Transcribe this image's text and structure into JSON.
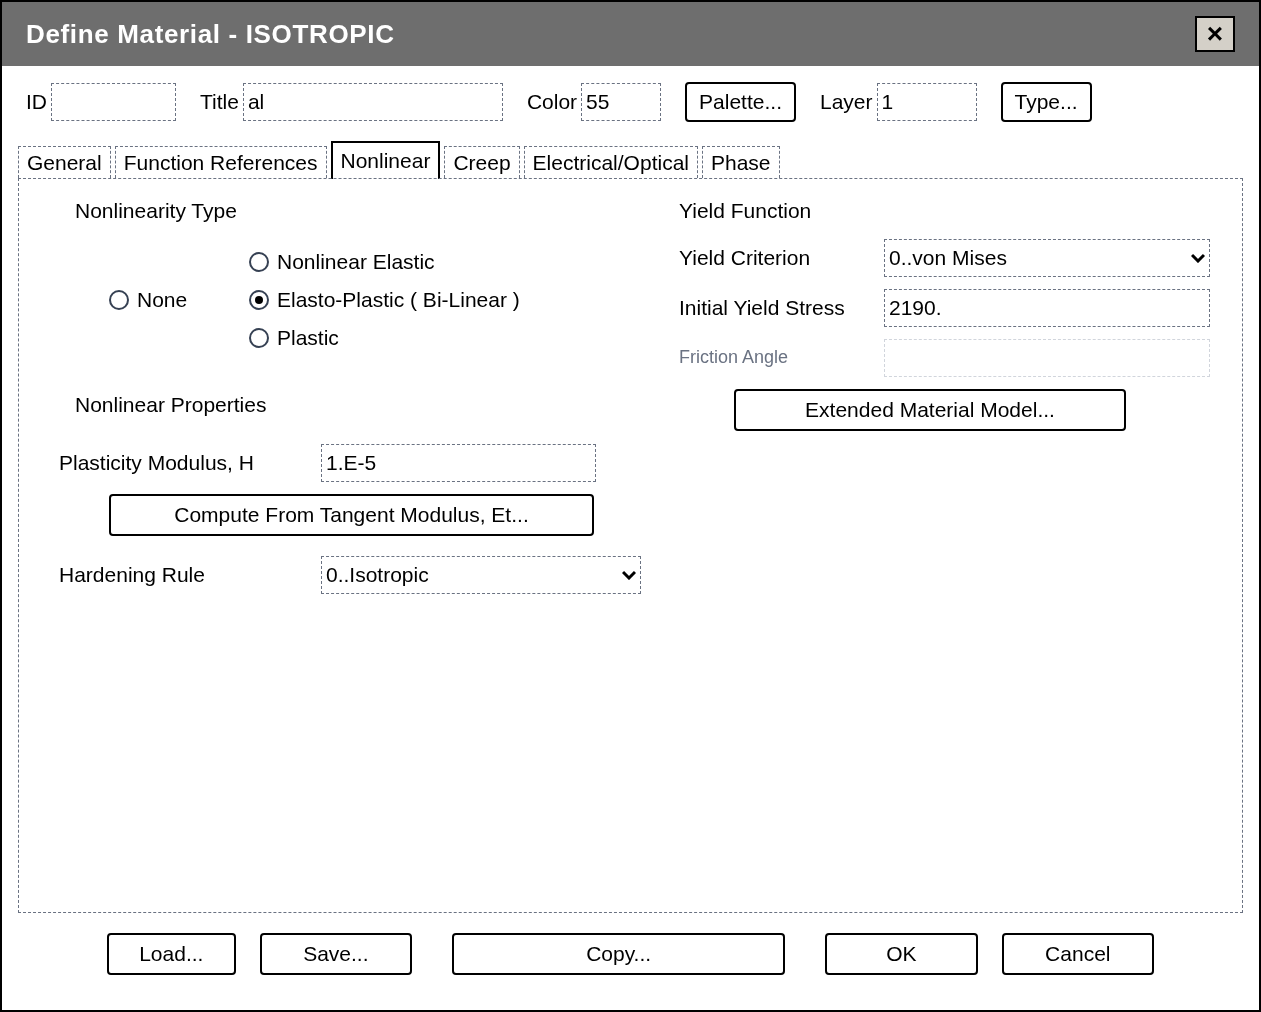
{
  "window": {
    "title": "Define Material - ISOTROPIC",
    "close": "×"
  },
  "header": [
    {
      "label": "ID",
      "kind": "field"
    },
    {
      "label": "Title",
      "value": "al",
      "kind": "field"
    },
    {
      "label": "Color",
      "value": "55",
      "kind": "field"
    },
    {
      "label": "Palette...",
      "kind": "button"
    },
    {
      "label": "Layer",
      "value": "1",
      "kind": "field"
    },
    {
      "label": "Type...",
      "kind": "button"
    }
  ],
  "tabs": [
    {
      "label": "General",
      "selected": false
    },
    {
      "label": "Function References",
      "selected": false
    },
    {
      "label": "Nonlinear",
      "selected": true
    },
    {
      "label": "Creep",
      "selected": false
    },
    {
      "label": "Electrical/Optical",
      "selected": false
    },
    {
      "label": "Phase",
      "selected": false
    }
  ],
  "nonlinearity_type": {
    "title": "Nonlinearity Type",
    "options": [
      {
        "label": "None",
        "selected": false
      },
      {
        "label": "Nonlinear Elastic",
        "selected": false
      },
      {
        "label": "Elasto-Plastic ( Bi-Linear )",
        "selected": true
      },
      {
        "label": "Plastic",
        "selected": false
      }
    ]
  },
  "nonlinear_properties": {
    "title": "Nonlinear Properties",
    "plasticity_modulus": {
      "label": "Plasticity Modulus, H",
      "value": "1.E-5"
    },
    "compute_button": "Compute From Tangent Modulus, Et...",
    "hardening_rule": {
      "label": "Hardening Rule",
      "value": "0..Isotropic"
    }
  },
  "yield_function": {
    "title": "Yield Function",
    "yield_criterion": {
      "label": "Yield Criterion",
      "value": "0..von Mises"
    },
    "initial_yield_stress": {
      "label": "Initial Yield Stress",
      "value": "2190."
    },
    "friction_angle": {
      "label": "Friction Angle",
      "disabled": true
    },
    "extended_button": "Extended Material Model..."
  },
  "buttons": [
    "Load...",
    "Save...",
    "Copy...",
    "OK",
    "Cancel"
  ]
}
